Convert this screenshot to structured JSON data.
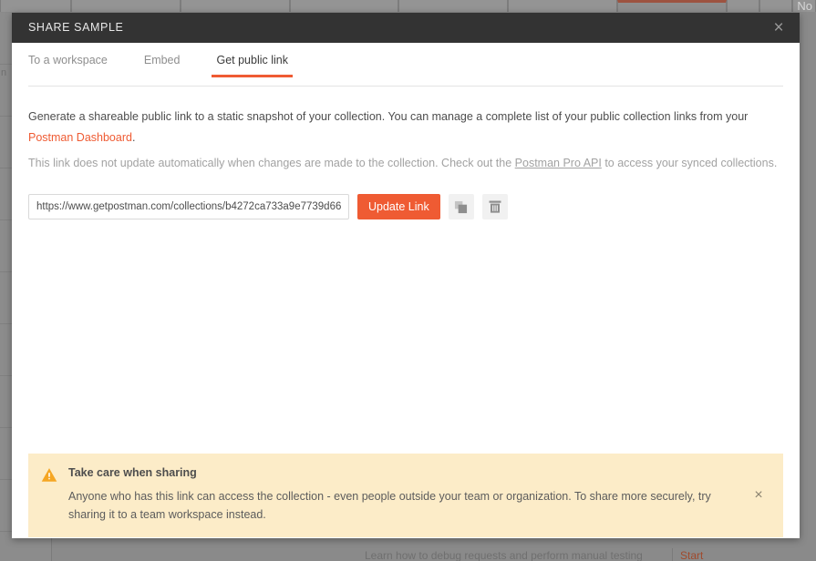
{
  "background": {
    "top_right_label": "No",
    "sidebar_hint": "n",
    "footer_hint": "Learn how to debug requests and perform manual testing",
    "footer_action": "Start",
    "tabs": [
      {
        "width": 78
      },
      {
        "width": 120
      },
      {
        "width": 120
      },
      {
        "width": 120
      },
      {
        "width": 120
      },
      {
        "width": 120
      },
      {
        "width": 120
      },
      {
        "width": 36
      },
      {
        "width": 36
      },
      {
        "width": 26
      }
    ],
    "active_tab_index": 6
  },
  "modal": {
    "title": "SHARE SAMPLE",
    "close_label": "×",
    "tabs": [
      {
        "id": "to-a-workspace",
        "label": "To a workspace",
        "active": false
      },
      {
        "id": "embed",
        "label": "Embed",
        "active": false
      },
      {
        "id": "get-public-link",
        "label": "Get public link",
        "active": true
      }
    ],
    "description": {
      "part1": "Generate a shareable public link to a static snapshot of your collection. You can manage a complete list of your public collection links from your ",
      "link_dashboard": "Postman Dashboard",
      "part2": ".",
      "note_part1": "This link does not update automatically when changes are made to the collection. Check out the ",
      "link_pro_api": "Postman Pro API",
      "note_part2": " to access your synced collections."
    },
    "link_field": {
      "value": "https://www.getpostman.com/collections/b4272ca733a9e7739d66",
      "placeholder": "https://www.getpostman.com/collections/"
    },
    "update_button_label": "Update Link",
    "copy_icon_name": "copy-icon",
    "delete_icon_name": "trash-icon",
    "warning": {
      "icon_name": "warning-triangle-icon",
      "title": "Take care when sharing",
      "body": "Anyone who has this link can access the collection - even people outside your team or organization. To share more securely, try sharing it to a team workspace instead.",
      "close_label": "×"
    }
  },
  "colors": {
    "accent_orange": "#ef5b33",
    "header_dark": "#333333",
    "warning_bg": "#fcecc8",
    "warning_icon": "#f5a623",
    "muted_text": "#a2a2a2"
  }
}
